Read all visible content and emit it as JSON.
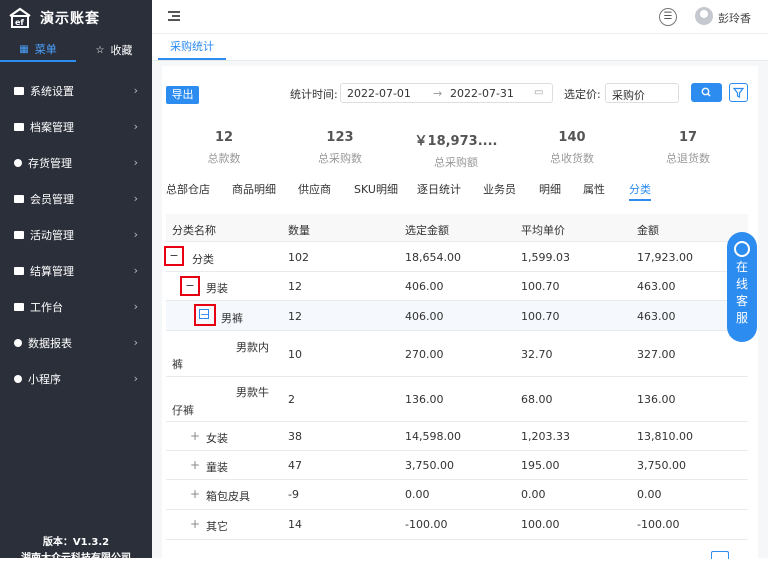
{
  "app": {
    "title": "演示账套",
    "version": "版本：V1.3.2",
    "company": "湖南大众云科技有限公司"
  },
  "sidebar_tabs": [
    {
      "label": "菜单",
      "icon": "grid-icon"
    },
    {
      "label": "收藏",
      "icon": "star-icon"
    }
  ],
  "menu": [
    {
      "label": "系统设置"
    },
    {
      "label": "档案管理"
    },
    {
      "label": "存货管理"
    },
    {
      "label": "会员管理"
    },
    {
      "label": "活动管理"
    },
    {
      "label": "结算管理"
    },
    {
      "label": "工作台"
    },
    {
      "label": "数据报表"
    },
    {
      "label": "小程序"
    }
  ],
  "topbar": {
    "username": "彭玲香",
    "circle_icon_text": "☰"
  },
  "page_tab": "采购统计",
  "toolbar": {
    "export_label": "导出",
    "time_label": "统计时间:",
    "date_start": "2022-07-01",
    "date_end": "2022-07-31",
    "price_label": "选定价:",
    "price_value": "采购价"
  },
  "stats": [
    {
      "value": "12",
      "label": "总款数"
    },
    {
      "value": "123",
      "label": "总采购数"
    },
    {
      "value": "￥18,973....",
      "label": "总采购额"
    },
    {
      "value": "140",
      "label": "总收货数"
    },
    {
      "value": "17",
      "label": "总退货数"
    }
  ],
  "subtabs": [
    "总部仓店",
    "商品明细",
    "供应商",
    "SKU明细",
    "逐日统计",
    "业务员",
    "明细",
    "属性",
    "分类"
  ],
  "active_subtab": "分类",
  "table": {
    "headers": [
      "分类名称",
      "数量",
      "选定金额",
      "平均单价",
      "金额"
    ],
    "rows": [
      {
        "name": "分类",
        "qty": "102",
        "sel": "18,654.00",
        "avg": "1,599.03",
        "amt": "17,923.00"
      },
      {
        "name": "男装",
        "qty": "12",
        "sel": "406.00",
        "avg": "100.70",
        "amt": "463.00"
      },
      {
        "name": "男裤",
        "qty": "12",
        "sel": "406.00",
        "avg": "100.70",
        "amt": "463.00"
      },
      {
        "name_a": "男款内",
        "name_b": "裤",
        "qty": "10",
        "sel": "270.00",
        "avg": "32.70",
        "amt": "327.00"
      },
      {
        "name_a": "男款牛",
        "name_b": "仔裤",
        "qty": "2",
        "sel": "136.00",
        "avg": "68.00",
        "amt": "136.00"
      },
      {
        "name": "女装",
        "qty": "38",
        "sel": "14,598.00",
        "avg": "1,203.33",
        "amt": "13,810.00"
      },
      {
        "name": "童装",
        "qty": "47",
        "sel": "3,750.00",
        "avg": "195.00",
        "amt": "3,750.00"
      },
      {
        "name": "箱包皮具",
        "qty": "-9",
        "sel": "0.00",
        "avg": "0.00",
        "amt": "0.00"
      },
      {
        "name": "其它",
        "qty": "14",
        "sel": "-100.00",
        "avg": "100.00",
        "amt": "-100.00"
      }
    ]
  },
  "float_service": [
    "在",
    "线",
    "客",
    "服"
  ],
  "colors": {
    "primary": "#2d8cf0",
    "sidebar": "#2b2f3a",
    "highlight_box": "#e60012"
  }
}
